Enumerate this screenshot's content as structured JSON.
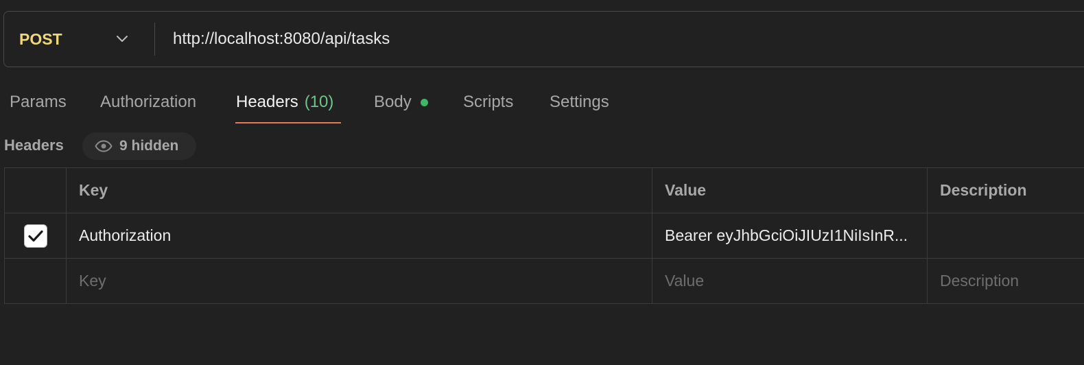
{
  "request": {
    "method": "POST",
    "url": "http://localhost:8080/api/tasks"
  },
  "tabs": [
    {
      "label": "Params"
    },
    {
      "label": "Authorization"
    },
    {
      "label": "Headers",
      "count": "(10)",
      "active": true
    },
    {
      "label": "Body",
      "indicator": "green-dot"
    },
    {
      "label": "Scripts"
    },
    {
      "label": "Settings"
    }
  ],
  "headers_section": {
    "title": "Headers",
    "hidden_label": "9 hidden"
  },
  "table": {
    "columns": [
      "Key",
      "Value",
      "Description"
    ],
    "rows": [
      {
        "enabled": true,
        "key": "Authorization",
        "value": "Bearer eyJhbGciOiJIUzI1NiIsInR...",
        "description": ""
      }
    ],
    "placeholder": {
      "key": "Key",
      "value": "Value",
      "description": "Description"
    }
  },
  "colors": {
    "method": "#f0d77a",
    "active_tab_underline": "#e8795a",
    "count": "#6fc48a",
    "body_dot": "#3fb56a"
  }
}
